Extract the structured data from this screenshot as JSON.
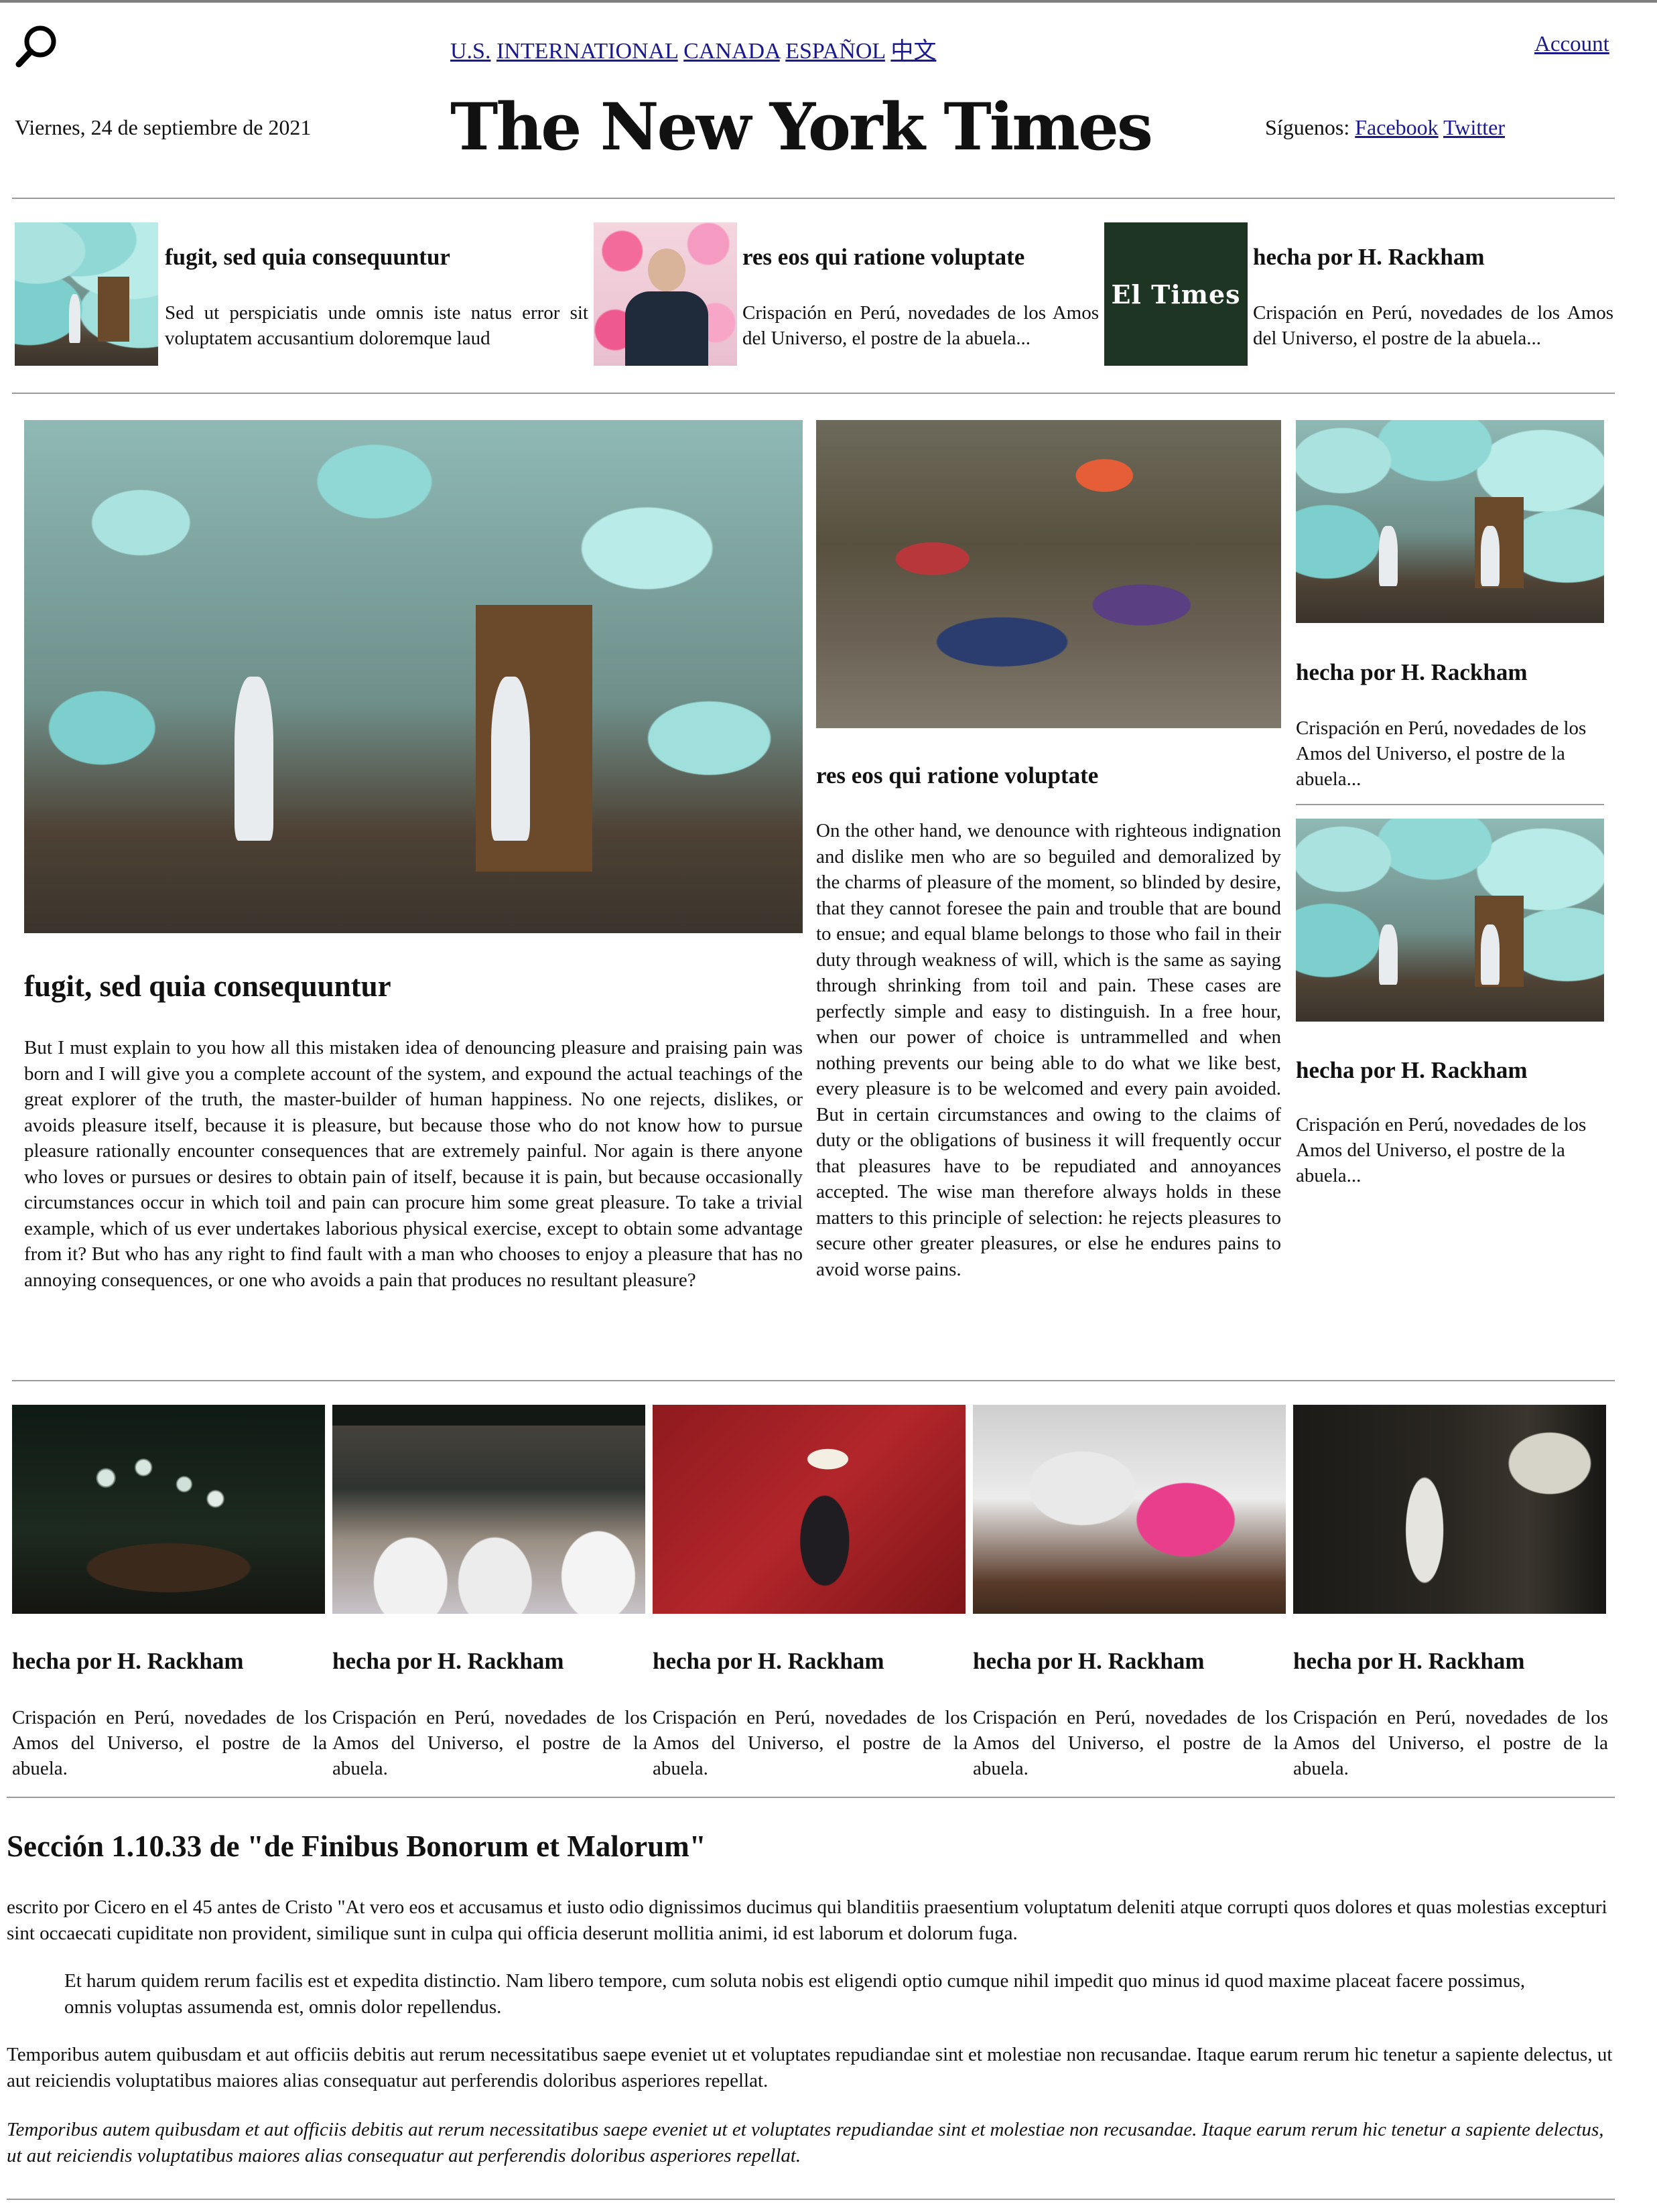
{
  "header": {
    "search_icon": "search-icon",
    "editions": [
      "U.S.",
      "INTERNATIONAL",
      "CANADA",
      "ESPAÑOL",
      "中文"
    ],
    "account": "Account",
    "date": "Viernes, 24 de septiembre de 2021",
    "logo": "The New York Times",
    "follow_label": "Síguenos:",
    "follow_links": [
      "Facebook",
      "Twitter"
    ]
  },
  "top_row": [
    {
      "headline": "fugit, sed quia consequuntur",
      "summary": "Sed ut perspiciatis unde omnis iste natus error sit voluptatem accusantium doloremque laud"
    },
    {
      "headline": "res eos qui ratione voluptate",
      "summary": "Crispación en Perú, novedades de los Amos del Universo, el postre de la abuela..."
    },
    {
      "headline": "hecha por H. Rackham",
      "summary": "Crispación en Perú, novedades de los Amos del Universo, el postre de la abuela...",
      "image_text": "El Times"
    }
  ],
  "lead": {
    "headline": "fugit, sed quia consequuntur",
    "body": "But I must explain to you how all this mistaken idea of denouncing pleasure and praising pain was born and I will give you a complete account of the system, and expound the actual teachings of the great explorer of the truth, the master-builder of human happiness. No one rejects, dislikes, or avoids pleasure itself, because it is pleasure, but because those who do not know how to pursue pleasure rationally encounter consequences that are extremely painful. Nor again is there anyone who loves or pursues or desires to obtain pain of itself, because it is pain, but because occasionally circumstances occur in which toil and pain can procure him some great pleasure. To take a trivial example, which of us ever undertakes laborious physical exercise, except to obtain some advantage from it? But who has any right to find fault with a man who chooses to enjoy a pleasure that has no annoying consequences, or one who avoids a pain that produces no resultant pleasure?"
  },
  "second": {
    "headline": "res eos qui ratione voluptate",
    "body": "On the other hand, we denounce with righteous indignation and dislike men who are so beguiled and demoralized by the charms of pleasure of the moment, so blinded by desire, that they cannot foresee the pain and trouble that are bound to ensue; and equal blame belongs to those who fail in their duty through weakness of will, which is the same as saying through shrinking from toil and pain. These cases are perfectly simple and easy to distinguish. In a free hour, when our power of choice is untrammelled and when nothing prevents our being able to do what we like best, every pleasure is to be welcomed and every pain avoided. But in certain circumstances and owing to the claims of duty or the obligations of business it will frequently occur that pleasures have to be repudiated and annoyances accepted. The wise man therefore always holds in these matters to this principle of selection: he rejects pleasures to secure other greater pleasures, or else he endures pains to avoid worse pains."
  },
  "side": [
    {
      "headline": "hecha por H. Rackham",
      "summary": "Crispación en Perú, novedades de los Amos del Universo, el postre de la abuela..."
    },
    {
      "headline": "hecha por H. Rackham",
      "summary": "Crispación en Perú, novedades de los Amos del Universo, el postre de la abuela..."
    }
  ],
  "bottom_row": [
    {
      "headline": "hecha por H. Rackham",
      "summary": "Crispación en Perú, novedades de los Amos del Universo, el postre de la abuela."
    },
    {
      "headline": "hecha por H. Rackham",
      "summary": "Crispación en Perú, novedades de los Amos del Universo, el postre de la abuela."
    },
    {
      "headline": "hecha por H. Rackham",
      "summary": "Crispación en Perú, novedades de los Amos del Universo, el postre de la abuela."
    },
    {
      "headline": "hecha por H. Rackham",
      "summary": "Crispación en Perú, novedades de los Amos del Universo, el postre de la abuela."
    },
    {
      "headline": "hecha por H. Rackham",
      "summary": "Crispación en Perú, novedades de los Amos del Universo, el postre de la abuela."
    }
  ],
  "section": {
    "title": "Sección 1.10.33 de \"de Finibus Bonorum et Malorum\"",
    "p1": "escrito por Cicero en el 45 antes de Cristo \"At vero eos et accusamus et iusto odio dignissimos ducimus qui blanditiis praesentium voluptatum deleniti atque corrupti quos dolores et quas molestias excepturi sint occaecati cupiditate non provident, similique sunt in culpa qui officia deserunt mollitia animi, id est laborum et dolorum fuga.",
    "quote": "Et harum quidem rerum facilis est et expedita distinctio. Nam libero tempore, cum soluta nobis est eligendi optio cumque nihil impedit quo minus id quod maxime placeat facere possimus, omnis voluptas assumenda est, omnis dolor repellendus.",
    "p2": "Temporibus autem quibusdam et aut officiis debitis aut rerum necessitatibus saepe eveniet ut et voluptates repudiandae sint et molestiae non recusandae. Itaque earum rerum hic tenetur a sapiente delectus, ut aut reiciendis voluptatibus maiores alias consequatur aut perferendis doloribus asperiores repellat.",
    "p3": "Temporibus autem quibusdam et aut officiis debitis aut rerum necessitatibus saepe eveniet ut et voluptates repudiandae sint et molestiae non recusandae. Itaque earum rerum hic tenetur a sapiente delectus, ut aut reiciendis voluptatibus maiores alias consequatur aut perferendis doloribus asperiores repellat."
  },
  "colors": {
    "link": "#1a1a8c",
    "rule": "#9a9a9a",
    "el_times_bg": "#1e3524"
  }
}
